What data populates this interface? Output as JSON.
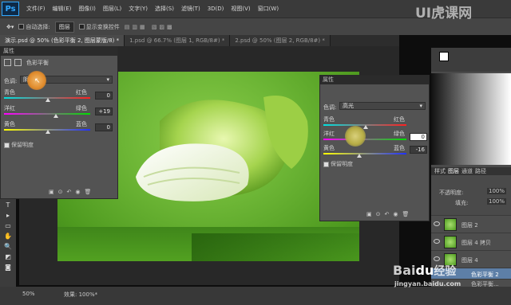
{
  "app": {
    "logo": "Ps",
    "menus": [
      "文件(F)",
      "编辑(E)",
      "图像(I)",
      "图层(L)",
      "文字(Y)",
      "选择(S)",
      "滤镜(T)",
      "3D(D)",
      "视图(V)",
      "窗口(W)"
    ]
  },
  "options": {
    "auto_select": "自动选择:",
    "auto_select_value": "图层",
    "transform": "显示变换控件"
  },
  "tabs": [
    "演示.psd @ 50% (色彩平衡 2, 图层蒙版/8) *",
    "1.psd @ 66.7% (图层 1, RGB/8#) *",
    "2.psd @ 50% (图层 2, RGB/8#) *"
  ],
  "left_props": {
    "panel_title": "属性",
    "adj_title": "色彩平衡",
    "tone_label": "色调:",
    "tone_value": "阴影",
    "row1": {
      "left": "青色",
      "right": "红色",
      "value": "0"
    },
    "row2": {
      "left": "洋红",
      "right": "绿色",
      "value": "+19"
    },
    "row3": {
      "left": "黄色",
      "right": "蓝色",
      "value": "0"
    },
    "preserve": "保留明度"
  },
  "right_props": {
    "panel_title": "属性",
    "tone_label": "色调:",
    "tone_value": "高光",
    "row1": {
      "left": "青色",
      "right": "红色",
      "value": "0"
    },
    "row2": {
      "left": "洋红",
      "right": "绿色",
      "value": "0"
    },
    "row3": {
      "left": "黄色",
      "right": "蓝色",
      "value": "-16"
    },
    "preserve": "保留明度"
  },
  "layers_panel": {
    "tabs": [
      "样式",
      "图层",
      "通道",
      "路径"
    ],
    "opacity_label": "不透明度:",
    "opacity_value": "100%",
    "fill_label": "填充:",
    "fill_value": "100%",
    "layers": [
      "图层 2",
      "图层 4 拷贝",
      "图层 4",
      "色彩平衡 2",
      "色彩平衡..."
    ]
  },
  "status": {
    "zoom": "50%",
    "info": "效果: 100%*"
  },
  "watermarks": {
    "top": "UI虎课网",
    "bottom_brand": "Bai",
    "bottom_paw": "du",
    "bottom_cn": "经验",
    "bottom_url": "jingyan.baidu.com"
  },
  "colors": {
    "accent": "#31a8ff",
    "canvas_green": "#6cb535",
    "highlight_orange": "#e08a2a"
  }
}
